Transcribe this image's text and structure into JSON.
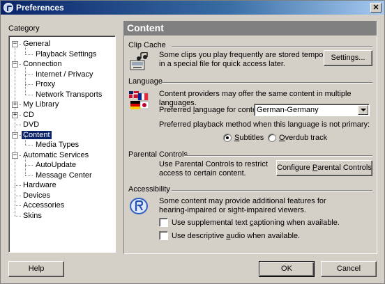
{
  "window": {
    "title": "Preferences",
    "close_symbol": "✕"
  },
  "sidebar": {
    "label": "Category",
    "items": [
      {
        "label": "General",
        "expander": "−"
      },
      {
        "label": "Playback Settings"
      },
      {
        "label": "Connection",
        "expander": "−"
      },
      {
        "label": "Internet / Privacy"
      },
      {
        "label": "Proxy"
      },
      {
        "label": "Network Transports"
      },
      {
        "label": "My Library",
        "expander": "+"
      },
      {
        "label": "CD",
        "expander": "+"
      },
      {
        "label": "DVD"
      },
      {
        "label": "Content",
        "expander": "−",
        "selected": true
      },
      {
        "label": "Media Types"
      },
      {
        "label": "Automatic Services",
        "expander": "−"
      },
      {
        "label": "AutoUpdate"
      },
      {
        "label": "Message Center"
      },
      {
        "label": "Hardware"
      },
      {
        "label": "Devices"
      },
      {
        "label": "Accessories"
      },
      {
        "label": "Skins"
      }
    ]
  },
  "panel": {
    "title": "Content",
    "clip_cache": {
      "title": "Clip Cache",
      "desc_line1": "Some clips you play frequently are stored temporarily",
      "desc_line2": "in a special file for quick access later.",
      "settings_button": "Settings..."
    },
    "language": {
      "title": "Language",
      "desc": "Content providers may offer the same content in multiple languages.",
      "preferred_label_pre": "Preferred ",
      "preferred_label_u": "l",
      "preferred_label_post": "anguage for content:",
      "preferred_value": "German-Germany",
      "playback_label": "Preferred playback method when this language is not primary:",
      "subtitles_u": "S",
      "subtitles_rest": "ubtitles",
      "overdub_u": "O",
      "overdub_rest": "verdub track",
      "selected_method": "Subtitles"
    },
    "parental": {
      "title": "Parental Controls",
      "desc_line1": "Use Parental Controls to restrict",
      "desc_line2": "access to certain content.",
      "button_pre": "Configure ",
      "button_u": "P",
      "button_post": "arental Controls"
    },
    "accessibility": {
      "title": "Accessibility",
      "desc_line1": "Some content may provide additional features for",
      "desc_line2": "hearing-impaired or sight-impaired viewers.",
      "captioning_pre": "Use supplemental text ",
      "captioning_u": "c",
      "captioning_post": "aptioning when available.",
      "captioning_checked": false,
      "audio_pre": "Use descriptive ",
      "audio_u": "a",
      "audio_post": "udio when available.",
      "audio_checked": false
    }
  },
  "footer": {
    "help": "Help",
    "ok": "OK",
    "cancel": "Cancel"
  },
  "colors": {
    "title_bar": "#0a246a",
    "selection": "#0a246a",
    "panel_header": "#808080",
    "face": "#d4d0c8"
  }
}
